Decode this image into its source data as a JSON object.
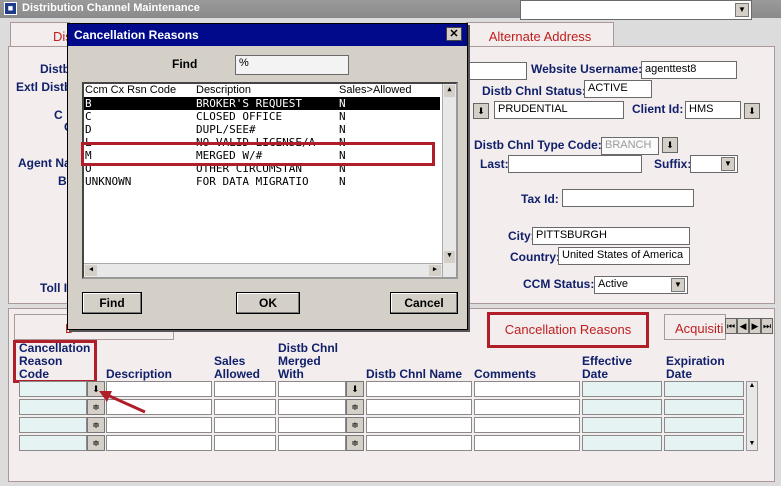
{
  "window": {
    "title": "Distribution Channel Maintenance"
  },
  "tabs": {
    "left_partial": "Dist",
    "alternate_address": "Alternate Address"
  },
  "labels": {
    "distb": "Distb",
    "extl_distb": "Extl Distb",
    "c1": "C",
    "c2": "C",
    "agent_na": "Agent Na",
    "br": "Br",
    "toll": "Toll I",
    "website_username": "Website Username:",
    "distb_chnl_status": "Distb Chnl Status:",
    "client_id": "Client Id:",
    "distb_chnl_type_code": "Distb Chnl Type Code:",
    "last": "Last:",
    "suffix": "Suffix:",
    "tax_id": "Tax Id:",
    "city": "City:",
    "country": "Country:",
    "ccm_status": "CCM Status:"
  },
  "fields": {
    "website_username": "agenttest8",
    "distb_chnl_status": "ACTIVE",
    "company": "PRUDENTIAL",
    "client_id": "HMS",
    "distb_chnl_type_code": "BRANCH",
    "city": "PITTSBURGH",
    "country": "United States of America",
    "ccm_status": "Active"
  },
  "dialog": {
    "title": "Cancellation Reasons",
    "find_label": "Find",
    "find_value": "%",
    "columns": [
      "Ccm Cx Rsn Code",
      "Description",
      "Sales>Allowed"
    ],
    "rows": [
      {
        "code": "B",
        "desc": "BROKER'S REQUEST",
        "sales": "N"
      },
      {
        "code": "C",
        "desc": "CLOSED OFFICE",
        "sales": "N"
      },
      {
        "code": "D",
        "desc": "DUPL/SEE#",
        "sales": "N"
      },
      {
        "code": "L",
        "desc": "NO VALID LICENSE/A",
        "sales": "N"
      },
      {
        "code": "M",
        "desc": "MERGED W/#",
        "sales": "N"
      },
      {
        "code": "O",
        "desc": "OTHER CIRCUMSTAN",
        "sales": "N"
      },
      {
        "code": "UNKNOWN",
        "desc": "FOR DATA MIGRATIO",
        "sales": "N"
      }
    ],
    "buttons": {
      "find": "Find",
      "ok": "OK",
      "cancel": "Cancel"
    }
  },
  "lower_tabs": {
    "left_partial": "D",
    "cancellation_reasons": "Cancellation Reasons",
    "acquisition_partial": "Acquisiti"
  },
  "grid": {
    "headers": {
      "reason_code": "Cancellation Reason Code",
      "description": "Description",
      "sales_allowed": "Sales Allowed",
      "merged_with": "Distb Chnl Merged With",
      "chnl_name": "Distb Chnl Name",
      "comments": "Comments",
      "effective_date": "Effective Date",
      "expiration_date": "Expiration Date"
    },
    "row_count": 4
  },
  "colors": {
    "title_blue": "#000a8a",
    "label_blue": "#10206a",
    "highlight_red": "#b01e2a",
    "tab_red": "#c01e1e"
  }
}
